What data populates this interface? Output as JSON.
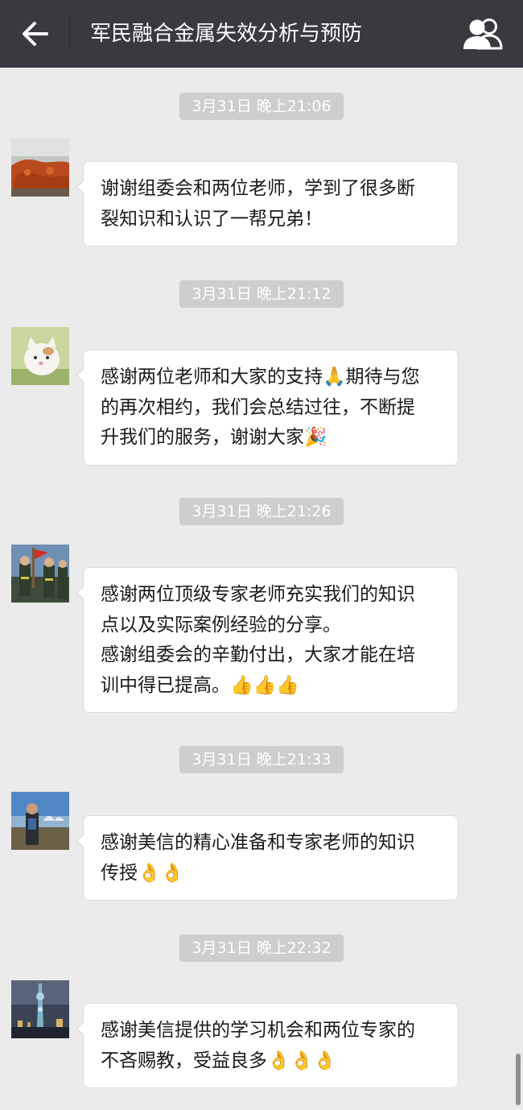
{
  "header": {
    "title": "军民融合金属失效分析与预防",
    "back_icon": "back-arrow-icon",
    "members_icon": "group-members-icon",
    "background": "#393a3f"
  },
  "messages": [
    {
      "timestamp": "3月31日 晚上21:06",
      "avatar": "avatar-orange-landscape",
      "lines": [
        "谢谢组委会和两位老师，学到了很多断",
        "裂知识和认识了一帮兄弟！"
      ]
    },
    {
      "timestamp": "3月31日 晚上21:12",
      "avatar": "avatar-cartoon-cat",
      "lines": [
        "感谢两位老师和大家的支持🙏期待与您",
        "的再次相约，我们会总结过往，不断提",
        "升我们的服务，谢谢大家🎉"
      ]
    },
    {
      "timestamp": "3月31日 晚上21:26",
      "avatar": "avatar-honor-guard",
      "lines": [
        "感谢两位顶级专家老师充实我们的知识",
        "点以及实际案例经验的分享。",
        "感谢组委会的辛勤付出，大家才能在培",
        "训中得已提高。👍👍👍"
      ]
    },
    {
      "timestamp": "3月31日 晚上21:33",
      "avatar": "avatar-person-harbor",
      "lines": [
        "感谢美信的精心准备和专家老师的知识",
        "传授👌👌"
      ]
    },
    {
      "timestamp": "3月31日 晚上22:32",
      "avatar": "avatar-night-tower",
      "lines": [
        "感谢美信提供的学习机会和两位专家的",
        "不吝赐教，受益良多👌👌👌"
      ]
    }
  ],
  "colors": {
    "chat_background": "#ebebeb",
    "timestamp_background": "#cecece",
    "bubble_background": "#ffffff"
  }
}
